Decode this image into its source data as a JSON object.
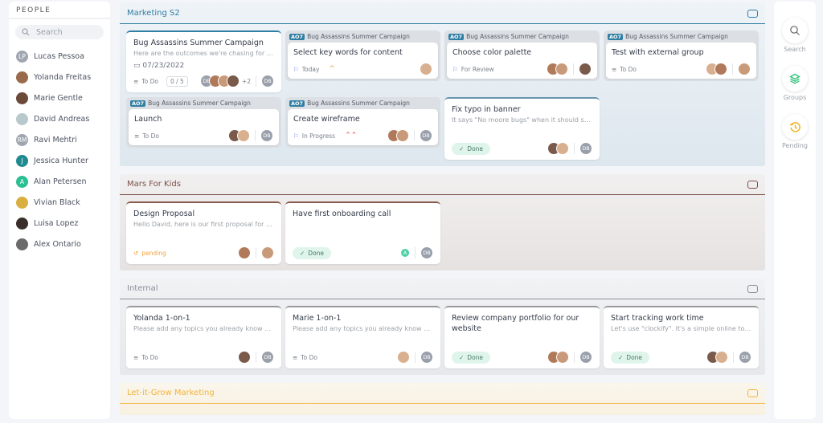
{
  "colors": {
    "todo": "#8a9099",
    "flag": "#6b7cf5",
    "photo": [
      "#b07a5a",
      "#c99a7a",
      "#7a5a4a",
      "#d8b090"
    ]
  },
  "left": {
    "header": "PEOPLE",
    "search_placeholder": "Search",
    "people": [
      {
        "name": "Lucas Pessoa",
        "initials": "LP",
        "color": "#a0a6b0"
      },
      {
        "name": "Yolanda Freitas",
        "initials": "",
        "color": "#9a6a4a"
      },
      {
        "name": "Marie Gentle",
        "initials": "",
        "color": "#6b4a3a"
      },
      {
        "name": "David Andreas",
        "initials": "",
        "color": "#b8c8cc"
      },
      {
        "name": "Ravi Mehtri",
        "initials": "RM",
        "color": "#a0a6b0"
      },
      {
        "name": "Jessica Hunter",
        "initials": "J",
        "color": "#1f8a8f"
      },
      {
        "name": "Alan Petersen",
        "initials": "A",
        "color": "#2bbf94"
      },
      {
        "name": "Vivian Black",
        "initials": "",
        "color": "#d9b040"
      },
      {
        "name": "Luisa Lopez",
        "initials": "",
        "color": "#3a2e2a"
      },
      {
        "name": "Alex Ontario",
        "initials": "",
        "color": "#6a6a6a"
      }
    ]
  },
  "right": {
    "buttons": [
      {
        "label": "Search",
        "icon": "search-icon"
      },
      {
        "label": "Groups",
        "icon": "layers-icon"
      },
      {
        "label": "Pending",
        "icon": "history-clock-icon"
      }
    ]
  },
  "sections": [
    {
      "title": "Marketing S2",
      "color": "#2f7ea3",
      "bg": "linear-gradient(180deg,#eef3f7,#dde7ee)",
      "cards": [
        {
          "kind": "plain",
          "title": "Bug Assassins Summer Campaign",
          "desc": "Here are the outcomes we're chasing for thi...",
          "date": "07/23/2022",
          "status": "todo",
          "status_label": "To Do",
          "count": "0 / 5",
          "avatars": [
            "DB",
            "p",
            "p",
            "p"
          ],
          "more": "+2",
          "owner": "DB",
          "border": "#2f7ea3"
        },
        {
          "kind": "group",
          "tag": "AO7",
          "group": "Bug Assassins Summer Campaign",
          "title": "Select key words for content",
          "status": "flag",
          "status_label": "Today",
          "priority": "^",
          "priority_color": "#f2a33a",
          "avatars": [],
          "owner": "p"
        },
        {
          "kind": "group",
          "tag": "AO7",
          "group": "Bug Assassins Summer Campaign",
          "title": "Choose color palette",
          "status": "flag",
          "status_label": "For Review",
          "avatars": [
            "p",
            "p"
          ],
          "owner": "p"
        },
        {
          "kind": "group",
          "tag": "AO7",
          "group": "Bug Assassins Summer Campaign",
          "title": "Test with external group",
          "status": "todo",
          "status_label": "To Do",
          "avatars": [
            "p",
            "p"
          ],
          "owner": "p"
        },
        {
          "kind": "group",
          "tag": "AO7",
          "group": "Bug Assassins Summer Campaign",
          "title": "Launch",
          "status": "todo",
          "status_label": "To Do",
          "avatars": [
            "p",
            "p"
          ],
          "owner": "DB"
        },
        {
          "kind": "group",
          "tag": "AO7",
          "group": "Bug Assassins Summer Campaign",
          "title": "Create wireframe",
          "status": "flag",
          "status_label": "In Progress",
          "priority": "⌃⌃",
          "priority_color": "#e5484d",
          "avatars": [
            "p",
            "p"
          ],
          "owner": "DB"
        },
        {
          "kind": "plain",
          "title": "Fix typo in banner",
          "desc": "It says \"No moore bugs\" when it should say ...",
          "status": "done",
          "status_label": "Done",
          "avatars": [
            "p",
            "p"
          ],
          "owner": "DB",
          "border": "#6a94ad",
          "tall": true
        }
      ]
    },
    {
      "title": "Mars For Kids",
      "color": "#7a5048",
      "bg": "linear-gradient(180deg,#f1efef,#e6e2e1)",
      "cards": [
        {
          "kind": "plain",
          "title": "Design Proposal",
          "desc": "Hello David, here is our first proposal for the...",
          "status": "pending",
          "status_label": "pending",
          "avatars": [
            "p"
          ],
          "owner": "p",
          "border": "#8a5a4a",
          "tall": true
        },
        {
          "kind": "plain",
          "title": "Have first onboarding call",
          "desc": "",
          "status": "done",
          "status_label": "Done",
          "avatars": [
            "A"
          ],
          "owner": "DB",
          "border": "#8a5a4a",
          "tall": true
        }
      ]
    },
    {
      "title": "Internal",
      "color": "#8a8f96",
      "bg": "linear-gradient(180deg,#f1f2f4,#e6e8eb)",
      "cards": [
        {
          "kind": "plain",
          "title": "Yolanda 1-on-1",
          "desc": "Please add any topics you already know you...",
          "status": "todo",
          "status_label": "To Do",
          "avatars": [
            "p"
          ],
          "owner": "DB",
          "border": "#999",
          "tall": true
        },
        {
          "kind": "plain",
          "title": "Marie 1-on-1",
          "desc": "Please add any topics you already know you...",
          "status": "todo",
          "status_label": "To Do",
          "avatars": [
            "p"
          ],
          "owner": "DB",
          "border": "#999",
          "tall": true
        },
        {
          "kind": "plain",
          "title": "Review company portfolio for our website",
          "desc": "",
          "status": "done",
          "status_label": "Done",
          "avatars": [
            "p",
            "p"
          ],
          "owner": "DB",
          "border": "#999",
          "tall": true
        },
        {
          "kind": "plain",
          "title": "Start tracking work time",
          "desc": "Let's use \"clockify\". It's a simple online tool a...",
          "status": "done",
          "status_label": "Done",
          "avatars": [
            "p",
            "p"
          ],
          "owner": "DB",
          "border": "#999",
          "tall": true
        }
      ]
    },
    {
      "title": "Let-it-Grow Marketing",
      "color": "#f2b43a",
      "bg": "linear-gradient(180deg,#fbf6ec,#f8f1e2)",
      "cards": []
    }
  ]
}
